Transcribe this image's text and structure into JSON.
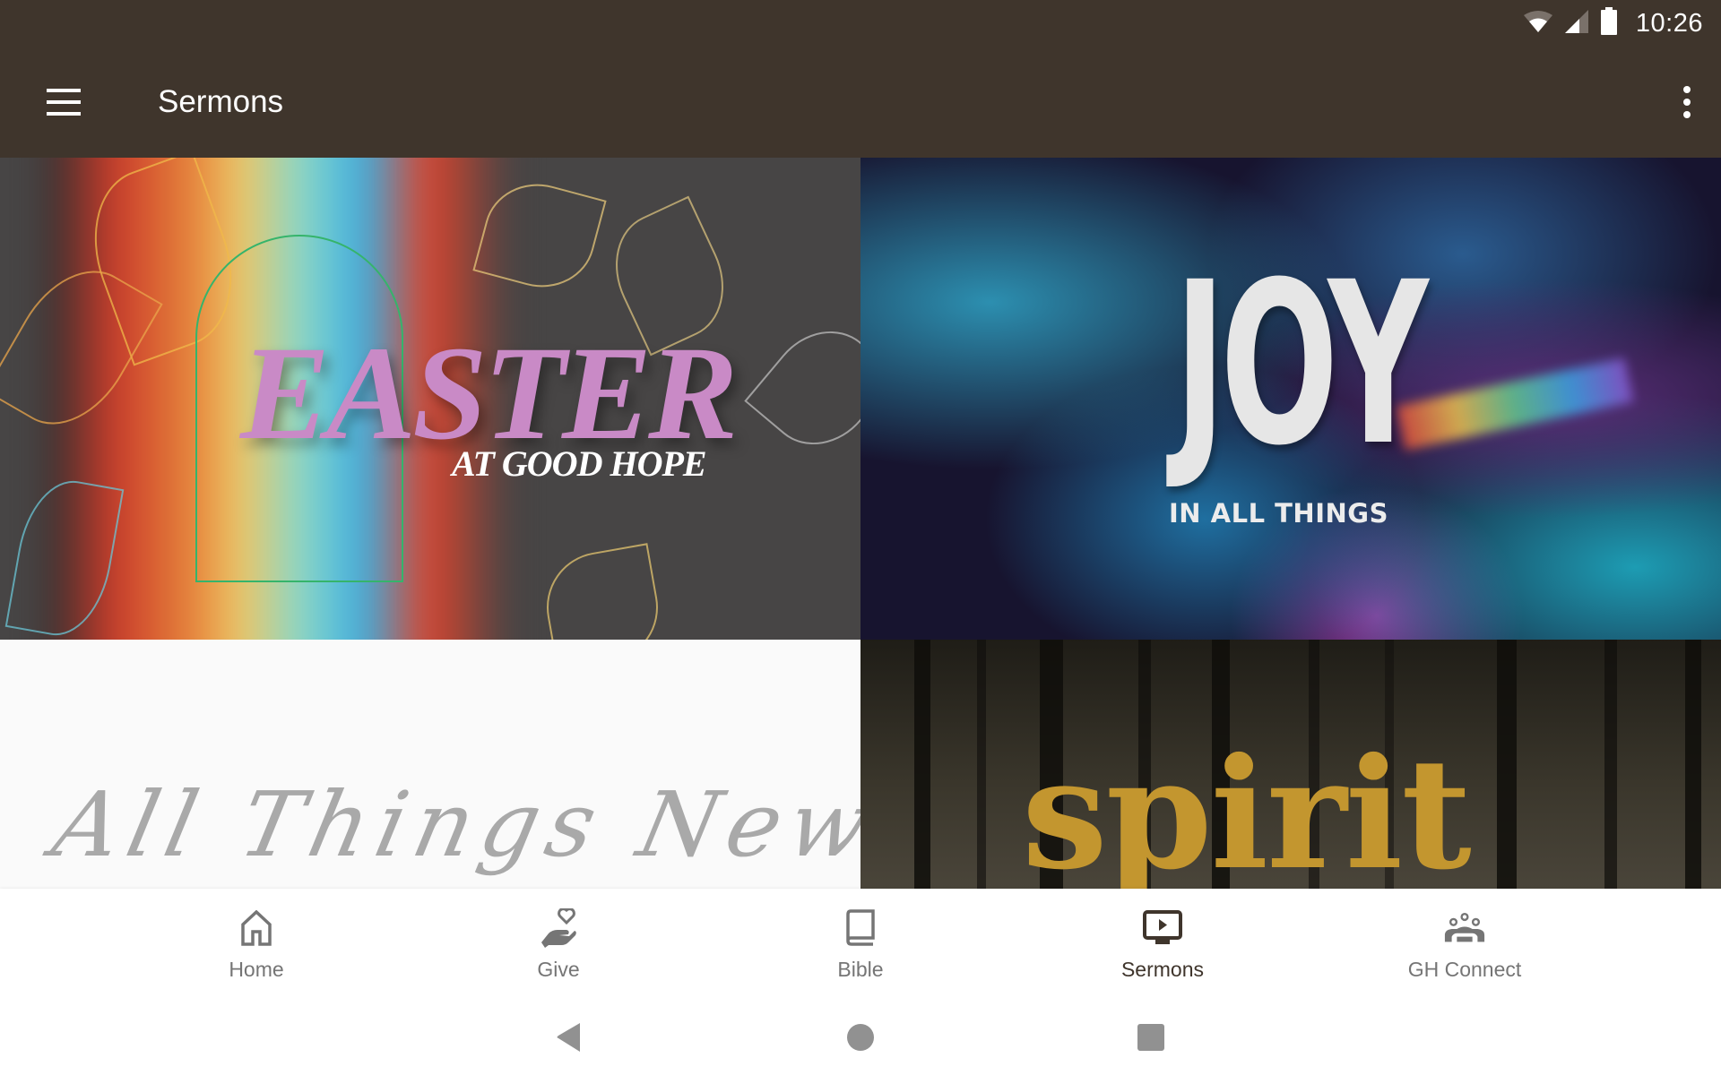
{
  "status_bar": {
    "time": "10:26",
    "icons": [
      "wifi-icon",
      "cell-signal-icon",
      "battery-icon"
    ]
  },
  "app_bar": {
    "title": "Sermons",
    "menu_icon": "hamburger-menu-icon",
    "overflow_icon": "more-vert-icon",
    "background_color": "#3f352c"
  },
  "sermon_series": [
    {
      "title": "EASTER",
      "subtitle": "AT GOOD HOPE"
    },
    {
      "title": "JOY",
      "subtitle": "IN ALL THINGS"
    },
    {
      "title": "All Things New",
      "subtitle": ""
    },
    {
      "title": "spirit",
      "subtitle": ""
    }
  ],
  "bottom_nav": {
    "items": [
      {
        "label": "Home",
        "icon": "home-icon",
        "active": false
      },
      {
        "label": "Give",
        "icon": "give-hand-heart-icon",
        "active": false
      },
      {
        "label": "Bible",
        "icon": "book-icon",
        "active": false
      },
      {
        "label": "Sermons",
        "icon": "video-play-icon",
        "active": true
      },
      {
        "label": "GH Connect",
        "icon": "groups-icon",
        "active": false
      }
    ],
    "active_color": "#3f352c",
    "inactive_color": "#757575"
  },
  "system_nav": {
    "buttons": [
      "back-icon",
      "home-circle-icon",
      "recents-square-icon"
    ]
  }
}
